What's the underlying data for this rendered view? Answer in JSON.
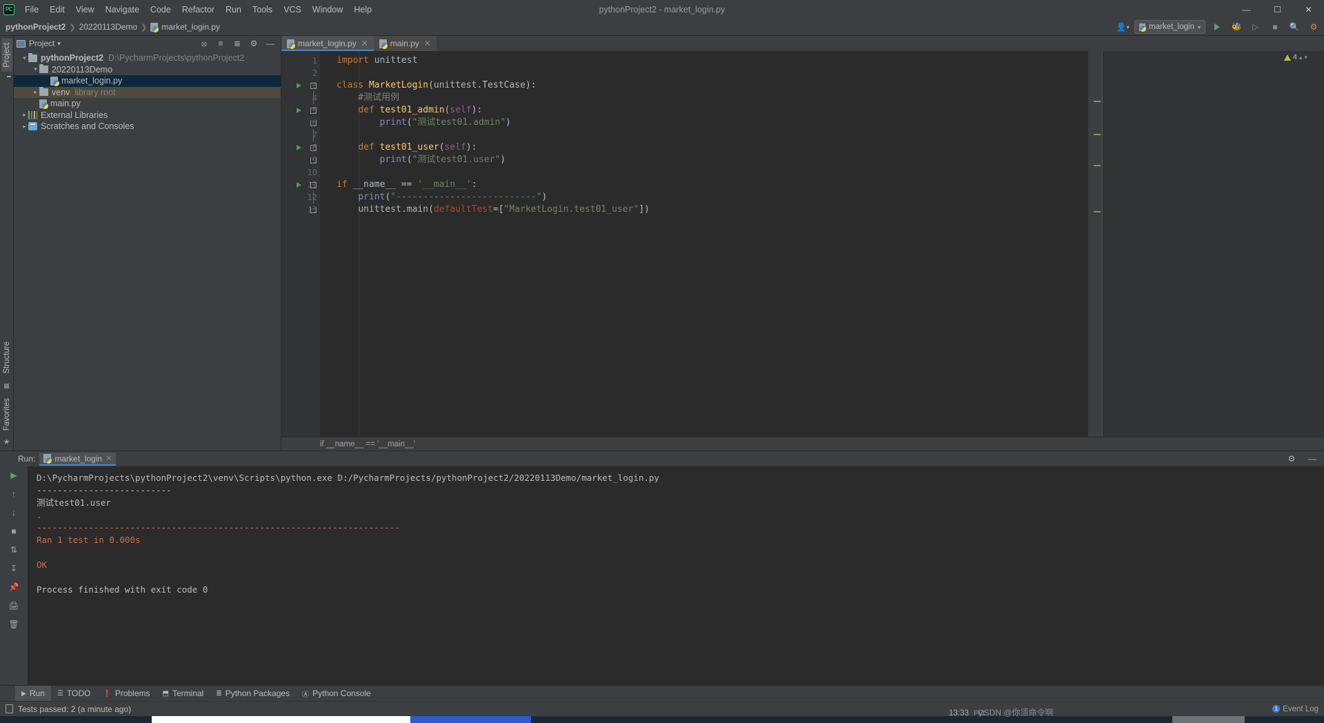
{
  "titlebar": {
    "logo": "PC",
    "menu": [
      "File",
      "Edit",
      "View",
      "Navigate",
      "Code",
      "Refactor",
      "Run",
      "Tools",
      "VCS",
      "Window",
      "Help"
    ],
    "window_title": "pythonProject2 - market_login.py",
    "minimize": "—",
    "maximize": "☐",
    "close": "✕"
  },
  "navbar": {
    "crumb_project": "pythonProject2",
    "crumb_folder": "20220113Demo",
    "crumb_file": "market_login.py",
    "run_config": "market_login",
    "search_icon": "🔍",
    "avatar_icon": "👤"
  },
  "leftstrip": {
    "project_tab": "Project",
    "structure_tab": "Structure",
    "favorites_tab": "Favorites"
  },
  "project_panel": {
    "title": "Project",
    "dropdown": "▾",
    "tree": [
      {
        "indent": 0,
        "arrow": "∨",
        "icon": "folder",
        "name": "pythonProject2",
        "bold": true,
        "sub": "D:\\PycharmProjects\\pythonProject2",
        "state": "normal"
      },
      {
        "indent": 1,
        "arrow": "∨",
        "icon": "folder",
        "name": "20220113Demo",
        "bold": false,
        "sub": "",
        "state": "normal"
      },
      {
        "indent": 2,
        "arrow": "",
        "icon": "py",
        "name": "market_login.py",
        "bold": false,
        "sub": "",
        "state": "selected"
      },
      {
        "indent": 1,
        "arrow": "›",
        "icon": "folder",
        "name": "venv",
        "bold": false,
        "sub": "library root",
        "state": "venv"
      },
      {
        "indent": 1,
        "arrow": "",
        "icon": "py",
        "name": "main.py",
        "bold": false,
        "sub": "",
        "state": "normal"
      },
      {
        "indent": 0,
        "arrow": "›",
        "icon": "lib",
        "name": "External Libraries",
        "bold": false,
        "sub": "",
        "state": "normal"
      },
      {
        "indent": 0,
        "arrow": "›",
        "icon": "scratch",
        "name": "Scratches and Consoles",
        "bold": false,
        "sub": "",
        "state": "normal"
      }
    ]
  },
  "editor": {
    "tabs": [
      {
        "label": "market_login.py",
        "active": true,
        "close": "✕"
      },
      {
        "label": "main.py",
        "active": false,
        "close": "✕"
      }
    ],
    "warnings_count": "4",
    "warning_icon": "⚠",
    "breadcrumb_bottom": "if __name__ == '__main__'",
    "lines": [
      {
        "n": "1",
        "text": "import unittest"
      },
      {
        "n": "2",
        "text": ""
      },
      {
        "n": "3",
        "text": "class MarketLogin(unittest.TestCase):"
      },
      {
        "n": "4",
        "text": "    #测试用例"
      },
      {
        "n": "5",
        "text": "    def test01_admin(self):"
      },
      {
        "n": "6",
        "text": "        print(\"测试test01.admin\")"
      },
      {
        "n": "7",
        "text": ""
      },
      {
        "n": "8",
        "text": "    def test01_user(self):"
      },
      {
        "n": "9",
        "text": "        print(\"测试test01.user\")"
      },
      {
        "n": "10",
        "text": ""
      },
      {
        "n": "11",
        "text": "if __name__ == '__main__':"
      },
      {
        "n": "12",
        "text": "    print(\"--------------------------\")"
      },
      {
        "n": "13",
        "text": "    unittest.main(defaultTest=[\"MarketLogin.test01_user\"])"
      }
    ]
  },
  "run_panel": {
    "label": "Run:",
    "tab_name": "market_login",
    "tab_close": "✕",
    "gear_icon": "⚙",
    "minimize_icon": "—",
    "console_lines": [
      {
        "text": "D:\\PycharmProjects\\pythonProject2\\venv\\Scripts\\python.exe D:/PycharmProjects/pythonProject2/20220113Demo/market_login.py",
        "color": "white"
      },
      {
        "text": "--------------------------",
        "color": "white"
      },
      {
        "text": "测试test01.user",
        "color": "white"
      },
      {
        "text": ".",
        "color": "red"
      },
      {
        "text": "----------------------------------------------------------------------",
        "color": "red"
      },
      {
        "text": "Ran 1 test in 0.000s",
        "color": "red"
      },
      {
        "text": "",
        "color": "red"
      },
      {
        "text": "OK",
        "color": "red"
      },
      {
        "text": "",
        "color": "white"
      },
      {
        "text": "Process finished with exit code 0",
        "color": "white"
      }
    ]
  },
  "tool_windows": [
    {
      "label": "Run",
      "icon": "▶",
      "active": true
    },
    {
      "label": "TODO",
      "icon": "☰",
      "active": false
    },
    {
      "label": "Problems",
      "icon": "❗",
      "active": false
    },
    {
      "label": "Terminal",
      "icon": "⬒",
      "active": false
    },
    {
      "label": "Python Packages",
      "icon": "≣",
      "active": false
    },
    {
      "label": "Python Console",
      "icon": "Ⓐ",
      "active": false
    }
  ],
  "statusbar": {
    "message": "Tests passed: 2 (a minute ago)",
    "time": "13:33",
    "lang": "Pyt",
    "event_log": "Event Log",
    "event_count": "1",
    "watermark": "CSDN @你须命令啊"
  }
}
